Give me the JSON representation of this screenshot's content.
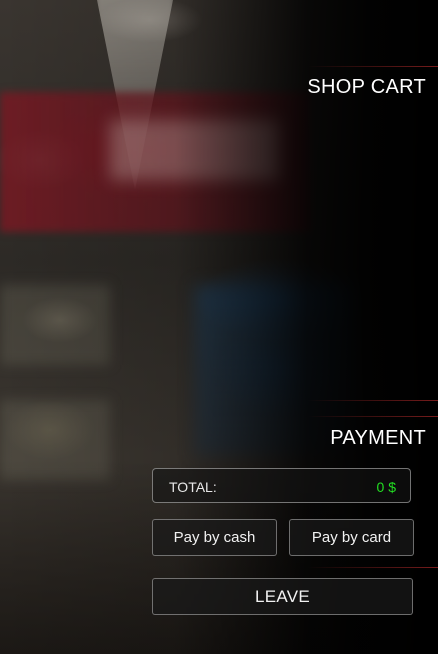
{
  "shop_cart": {
    "title": "SHOP CART"
  },
  "payment": {
    "title": "PAYMENT",
    "total_label": "TOTAL:",
    "total_amount": "0 $",
    "total_color": "#22dd22",
    "pay_cash_label": "Pay by cash",
    "pay_card_label": "Pay by card"
  },
  "actions": {
    "leave_label": "LEAVE"
  }
}
